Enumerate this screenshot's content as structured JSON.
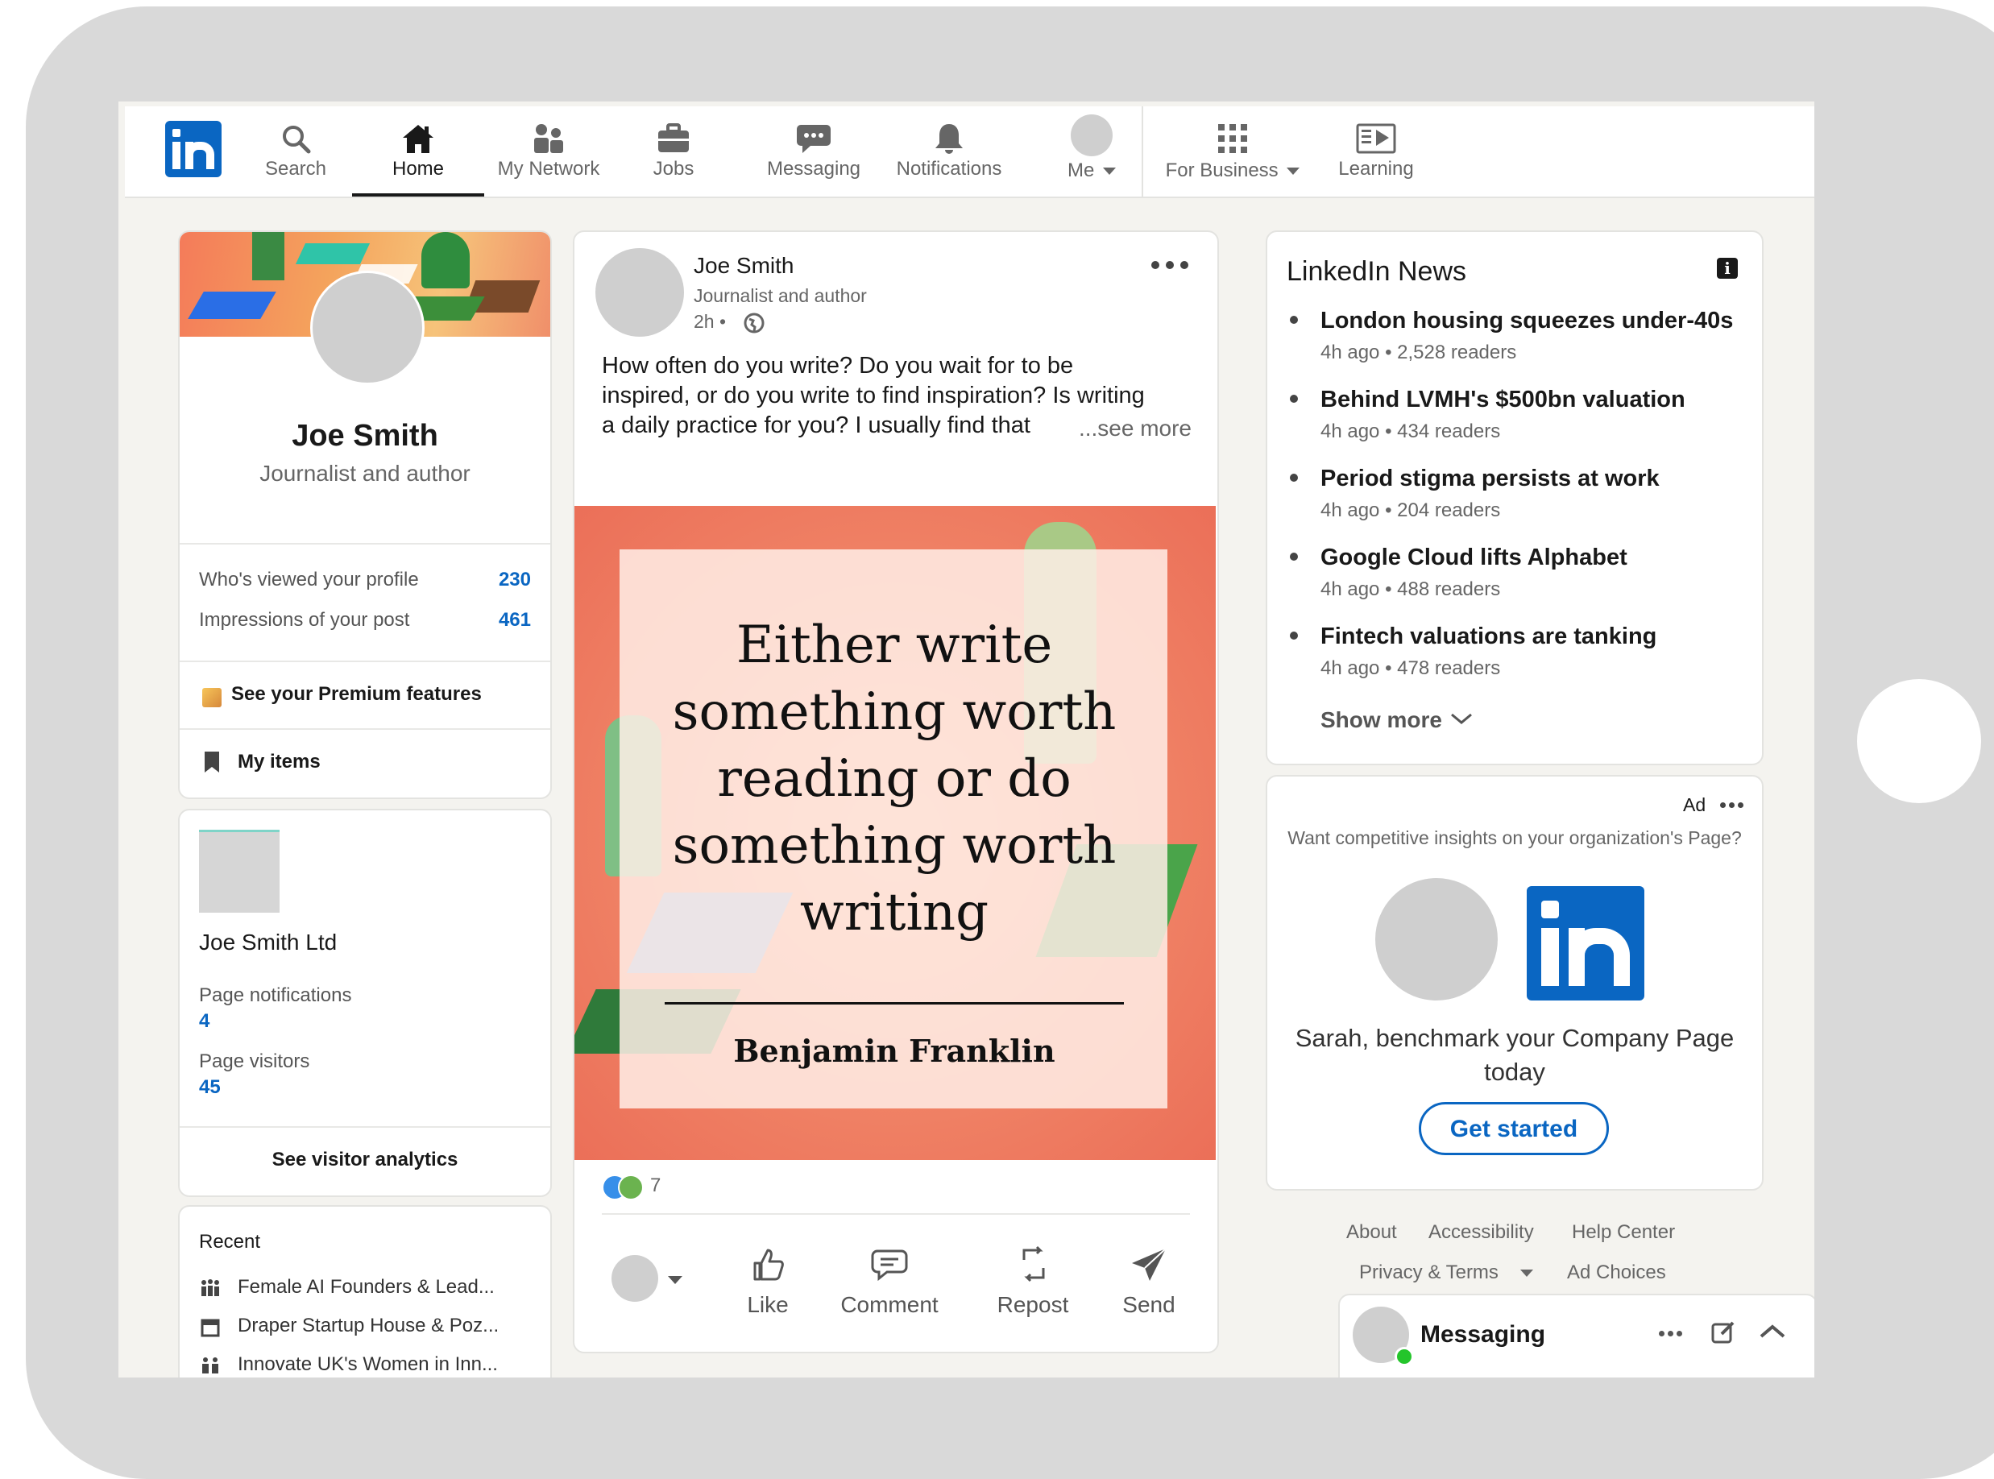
{
  "nav": {
    "items": [
      {
        "label": "Search",
        "icon": "search-icon"
      },
      {
        "label": "Home",
        "icon": "home-icon",
        "active": true
      },
      {
        "label": "My Network",
        "icon": "network-icon"
      },
      {
        "label": "Jobs",
        "icon": "briefcase-icon"
      },
      {
        "label": "Messaging",
        "icon": "chat-icon"
      },
      {
        "label": "Notifications",
        "icon": "bell-icon"
      },
      {
        "label": "Me",
        "icon": "avatar"
      },
      {
        "label": "For Business",
        "icon": "grid-icon"
      },
      {
        "label": "Learning",
        "icon": "learning-icon"
      }
    ]
  },
  "profile": {
    "name": "Joe Smith",
    "headline": "Journalist and author",
    "stats": [
      {
        "label": "Who's viewed your profile",
        "value": "230"
      },
      {
        "label": "Impressions of your post",
        "value": "461"
      }
    ],
    "premium": "See your Premium features",
    "my_items": "My items"
  },
  "page_card": {
    "name": "Joe Smith Ltd",
    "notifications_label": "Page notifications",
    "notifications_value": "4",
    "visitors_label": "Page visitors",
    "visitors_value": "45",
    "analytics": "See visitor analytics"
  },
  "recent": {
    "title": "Recent",
    "items": [
      "Female AI Founders & Lead...",
      "Draper Startup House & Poz...",
      "Innovate UK's Women in Inn..."
    ]
  },
  "post": {
    "author": "Joe Smith",
    "headline": "Journalist and author",
    "time": "2h •",
    "body_lines": [
      "How often do you write? Do you wait for to be",
      "inspired, or do you write to find inspiration? Is writing",
      "a daily practice for you? I usually find that"
    ],
    "see_more": "...see more",
    "quote_lines": [
      "Either write",
      "something worth",
      "reading or do",
      "something worth",
      "writing"
    ],
    "quote_author": "Benjamin Franklin",
    "reaction_count": "7",
    "actions": [
      {
        "label": "Like",
        "icon": "like-icon"
      },
      {
        "label": "Comment",
        "icon": "comment-icon"
      },
      {
        "label": "Repost",
        "icon": "repost-icon"
      },
      {
        "label": "Send",
        "icon": "send-icon"
      }
    ]
  },
  "news": {
    "title": "LinkedIn News",
    "items": [
      {
        "headline": "London housing squeezes under-40s",
        "meta": "4h ago • 2,528 readers"
      },
      {
        "headline": "Behind LVMH's $500bn valuation",
        "meta": "4h ago • 434 readers"
      },
      {
        "headline": "Period stigma persists at work",
        "meta": "4h ago • 204 readers"
      },
      {
        "headline": "Google Cloud lifts Alphabet",
        "meta": "4h ago • 488 readers"
      },
      {
        "headline": "Fintech valuations are tanking",
        "meta": "4h ago • 478 readers"
      }
    ],
    "show_more": "Show more"
  },
  "ad": {
    "label": "Ad",
    "prompt": "Want competitive insights on your organization's Page?",
    "cta_text": "Sarah, benchmark your Company Page today",
    "button": "Get started"
  },
  "footer": {
    "links_row1": [
      "About",
      "Accessibility",
      "Help Center"
    ],
    "privacy": "Privacy & Terms",
    "ad_choices": "Ad Choices"
  },
  "messaging": {
    "label": "Messaging"
  },
  "colors": {
    "brand": "#0a66c2",
    "quote_bg": "#f07a62",
    "online": "#24c52b"
  }
}
